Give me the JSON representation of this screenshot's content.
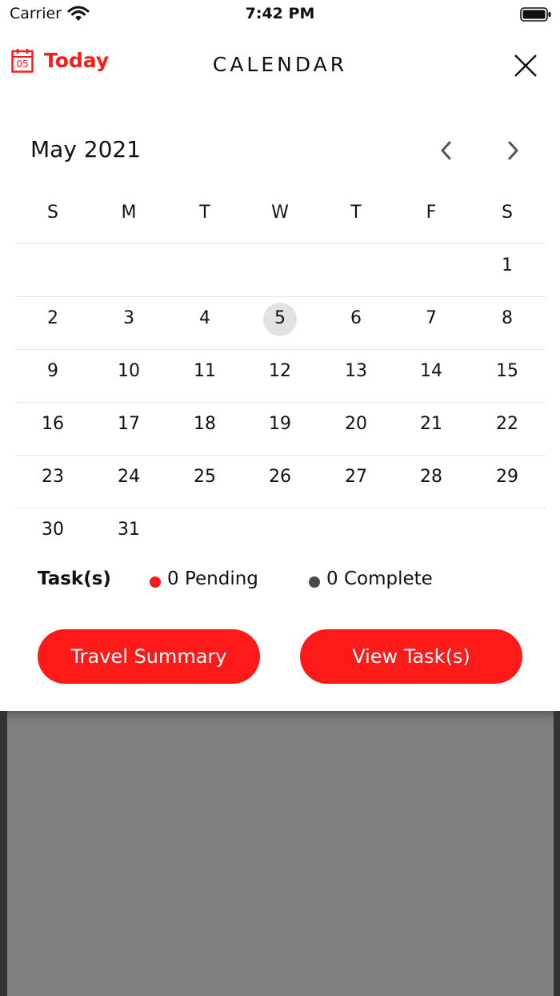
{
  "status_bar": {
    "carrier": "Carrier",
    "time": "7:42 PM"
  },
  "header": {
    "today_icon_day": "05",
    "today_label": "Today",
    "title": "CALENDAR"
  },
  "calendar": {
    "month_title": "May 2021",
    "weekdays": [
      "S",
      "M",
      "T",
      "W",
      "T",
      "F",
      "S"
    ],
    "weeks": [
      [
        "",
        "",
        "",
        "",
        "",
        "",
        "1"
      ],
      [
        "2",
        "3",
        "4",
        "5",
        "6",
        "7",
        "8"
      ],
      [
        "9",
        "10",
        "11",
        "12",
        "13",
        "14",
        "15"
      ],
      [
        "16",
        "17",
        "18",
        "19",
        "20",
        "21",
        "22"
      ],
      [
        "23",
        "24",
        "25",
        "26",
        "27",
        "28",
        "29"
      ],
      [
        "30",
        "31",
        "",
        "",
        "",
        "",
        ""
      ]
    ],
    "selected_day": "5"
  },
  "legend": {
    "tasks_label": "Task(s)",
    "pending": "0 Pending",
    "complete": "0 Complete"
  },
  "buttons": {
    "travel_summary": "Travel Summary",
    "view_tasks": "View Task(s)"
  },
  "colors": {
    "accent": "#ff1a1a",
    "selected_day_bg": "#e2e2e2",
    "complete_dot": "#4a4a4a",
    "backdrop": "#808080"
  }
}
